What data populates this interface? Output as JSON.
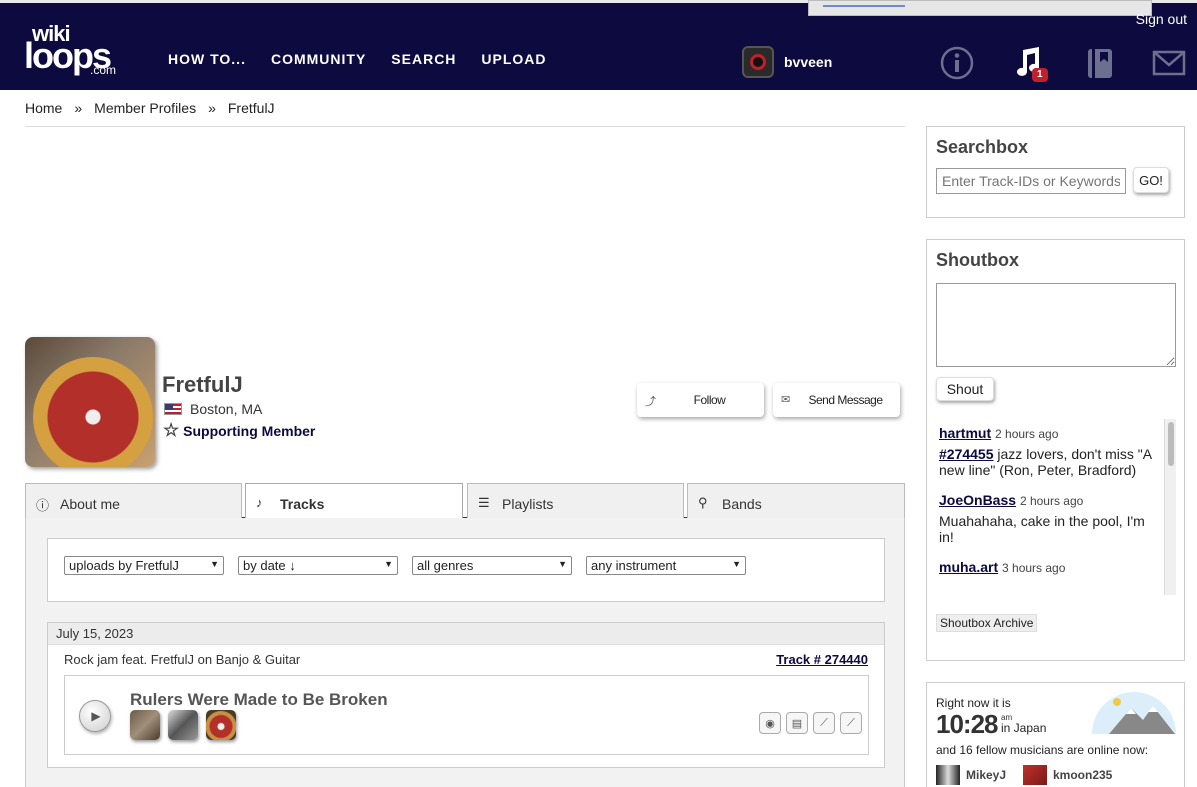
{
  "header": {
    "logo": {
      "wiki": "wiki",
      "loops": "loops",
      "com": ".com"
    },
    "sign_out": "Sign out",
    "nav": [
      "HOW TO...",
      "COMMUNITY",
      "SEARCH",
      "UPLOAD"
    ],
    "username": "bvveen",
    "icons": [
      "info-icon",
      "music-note-icon",
      "book-icon",
      "mail-icon"
    ],
    "music_badge": "1"
  },
  "breadcrumb": {
    "home": "Home",
    "members": "Member Profiles",
    "current": "FretfulJ",
    "separator": "»"
  },
  "profile": {
    "name": "FretfulJ",
    "location": "Boston, MA",
    "membership": "Supporting Member",
    "follow_label": "Follow",
    "message_label": "Send Message"
  },
  "tabs": [
    {
      "label": "About me",
      "icon": "info-icon"
    },
    {
      "label": "Tracks",
      "icon": "note-icon",
      "active": true
    },
    {
      "label": "Playlists",
      "icon": "list-icon"
    },
    {
      "label": "Bands",
      "icon": "guitars-icon"
    }
  ],
  "filters": {
    "uploads": "uploads by FretfulJ",
    "sort": "by date ↓",
    "genre": "all genres",
    "instrument": "any instrument"
  },
  "track": {
    "date": "July 15, 2023",
    "description": "Rock jam feat. FretfulJ on Banjo & Guitar",
    "number": "Track # 274440",
    "title": "Rulers Were Made to Be Broken",
    "instruments": [
      "drum-icon",
      "keyboard-icon",
      "banjo-icon",
      "guitar-icon"
    ]
  },
  "searchbox": {
    "title": "Searchbox",
    "placeholder": "Enter Track-IDs or Keywords",
    "go": "GO!"
  },
  "shoutbox": {
    "title": "Shoutbox",
    "shout_label": "Shout",
    "archive_label": "Shoutbox Archive",
    "items": [
      {
        "user": "hartmut",
        "time": "2 hours ago",
        "track": "#274455",
        "message": " jazz lovers, don't miss \"A new line\" (Ron, Peter, Bradford)"
      },
      {
        "user": "JoeOnBass",
        "time": "2 hours ago",
        "message": "Muahahaha, cake in the pool, I'm in!"
      },
      {
        "user": "muha.art",
        "time": "3 hours ago",
        "message": ""
      }
    ]
  },
  "online": {
    "label": "Right now it is",
    "time": "10:28",
    "ampm": "am",
    "location": "in Japan",
    "summary": "and 16 fellow musicians are online now:",
    "musicians": [
      "MikeyJ",
      "kmoon235"
    ]
  },
  "colors": {
    "header_bg": "#0c0a3e",
    "badge": "#c0202b",
    "link": "#0c0a3e"
  }
}
